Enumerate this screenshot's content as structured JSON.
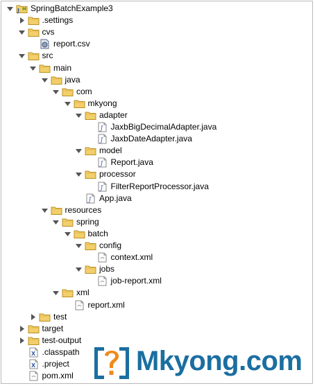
{
  "tree": [
    {
      "label": "SpringBatchExample3",
      "icon": "project-icon",
      "depth": 0,
      "expanded": true,
      "name": "tree-item-springbatchexample3"
    },
    {
      "label": ".settings",
      "icon": "folder-icon",
      "depth": 1,
      "expanded": false,
      "name": "tree-item-settings"
    },
    {
      "label": "cvs",
      "icon": "folder-icon",
      "depth": 1,
      "expanded": true,
      "name": "tree-item-cvs"
    },
    {
      "label": "report.csv",
      "icon": "csv-file-icon",
      "depth": 2,
      "leaf": true,
      "name": "tree-item-report-csv"
    },
    {
      "label": "src",
      "icon": "folder-icon",
      "depth": 1,
      "expanded": true,
      "name": "tree-item-src"
    },
    {
      "label": "main",
      "icon": "folder-icon",
      "depth": 2,
      "expanded": true,
      "name": "tree-item-main"
    },
    {
      "label": "java",
      "icon": "folder-icon",
      "depth": 3,
      "expanded": true,
      "name": "tree-item-java"
    },
    {
      "label": "com",
      "icon": "folder-icon",
      "depth": 4,
      "expanded": true,
      "name": "tree-item-com"
    },
    {
      "label": "mkyong",
      "icon": "folder-icon",
      "depth": 5,
      "expanded": true,
      "name": "tree-item-mkyong"
    },
    {
      "label": "adapter",
      "icon": "folder-icon",
      "depth": 6,
      "expanded": true,
      "name": "tree-item-adapter"
    },
    {
      "label": "JaxbBigDecimalAdapter.java",
      "icon": "java-file-icon",
      "depth": 7,
      "leaf": true,
      "name": "tree-item-jaxbbigdecimaladapter-java"
    },
    {
      "label": "JaxbDateAdapter.java",
      "icon": "java-file-icon",
      "depth": 7,
      "leaf": true,
      "name": "tree-item-jaxbdateadapter-java"
    },
    {
      "label": "model",
      "icon": "folder-icon",
      "depth": 6,
      "expanded": true,
      "name": "tree-item-model"
    },
    {
      "label": "Report.java",
      "icon": "java-file-icon",
      "depth": 7,
      "leaf": true,
      "name": "tree-item-report-java"
    },
    {
      "label": "processor",
      "icon": "folder-icon",
      "depth": 6,
      "expanded": true,
      "name": "tree-item-processor"
    },
    {
      "label": "FilterReportProcessor.java",
      "icon": "java-file-icon",
      "depth": 7,
      "leaf": true,
      "name": "tree-item-filterreportprocessor-java"
    },
    {
      "label": "App.java",
      "icon": "java-file-icon",
      "depth": 6,
      "leaf": true,
      "name": "tree-item-app-java"
    },
    {
      "label": "resources",
      "icon": "folder-icon",
      "depth": 3,
      "expanded": true,
      "name": "tree-item-resources"
    },
    {
      "label": "spring",
      "icon": "folder-icon",
      "depth": 4,
      "expanded": true,
      "name": "tree-item-spring"
    },
    {
      "label": "batch",
      "icon": "folder-icon",
      "depth": 5,
      "expanded": true,
      "name": "tree-item-batch"
    },
    {
      "label": "config",
      "icon": "folder-icon",
      "depth": 6,
      "expanded": true,
      "name": "tree-item-config"
    },
    {
      "label": "context.xml",
      "icon": "xml-file-icon",
      "depth": 7,
      "leaf": true,
      "name": "tree-item-context-xml"
    },
    {
      "label": "jobs",
      "icon": "folder-icon",
      "depth": 6,
      "expanded": true,
      "name": "tree-item-jobs"
    },
    {
      "label": "job-report.xml",
      "icon": "xml-file-icon",
      "depth": 7,
      "leaf": true,
      "name": "tree-item-job-report-xml"
    },
    {
      "label": "xml",
      "icon": "folder-icon",
      "depth": 4,
      "expanded": true,
      "name": "tree-item-xml"
    },
    {
      "label": "report.xml",
      "icon": "xml-file-icon",
      "depth": 5,
      "leaf": true,
      "name": "tree-item-report-xml"
    },
    {
      "label": "test",
      "icon": "folder-icon",
      "depth": 2,
      "expanded": false,
      "name": "tree-item-test"
    },
    {
      "label": "target",
      "icon": "folder-icon",
      "depth": 1,
      "expanded": false,
      "name": "tree-item-target"
    },
    {
      "label": "test-output",
      "icon": "folder-icon",
      "depth": 1,
      "expanded": false,
      "name": "tree-item-test-output"
    },
    {
      "label": ".classpath",
      "icon": "x-file-icon",
      "depth": 1,
      "leaf": true,
      "name": "tree-item-classpath"
    },
    {
      "label": ".project",
      "icon": "x-file-icon",
      "depth": 1,
      "leaf": true,
      "name": "tree-item-project"
    },
    {
      "label": "pom.xml",
      "icon": "xml-file-icon",
      "depth": 1,
      "leaf": true,
      "name": "tree-item-pom-xml"
    }
  ],
  "logo": {
    "text": "Mkyong.com",
    "mark": "question-mark-icon"
  },
  "colors": {
    "folder_fill": "#f2cf6b",
    "folder_stroke": "#b98f22",
    "twisty": "#555555",
    "logo_blue": "#1b6ea0",
    "logo_orange": "#f08a1c"
  }
}
